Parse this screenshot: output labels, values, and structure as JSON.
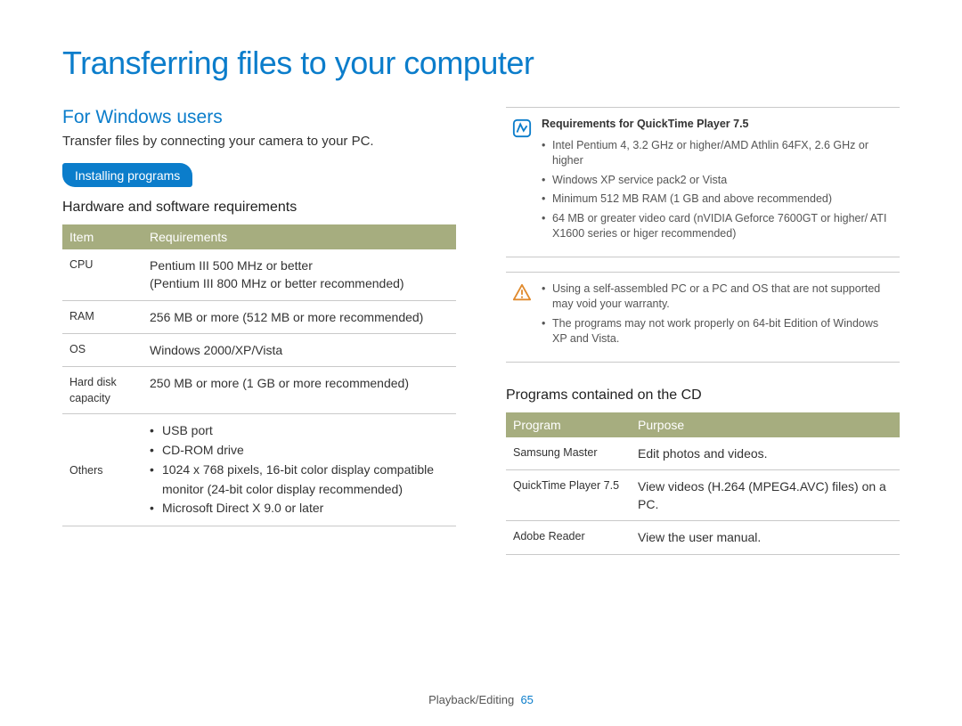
{
  "title": "Transferring files to your computer",
  "left": {
    "heading": "For Windows users",
    "sub": "Transfer files by connecting your camera to your PC.",
    "pill": "Installing programs",
    "subheading": "Hardware and software requirements",
    "req_table": {
      "head_item": "Item",
      "head_req": "Requirements",
      "rows": {
        "cpu_item": "CPU",
        "cpu_req_l1": "Pentium III 500 MHz or better",
        "cpu_req_l2": "(Pentium III 800 MHz or better recommended)",
        "ram_item": "RAM",
        "ram_req": "256 MB or more (512 MB or more recommended)",
        "os_item": "OS",
        "os_req": "Windows 2000/XP/Vista",
        "hd_item_l1": "Hard disk",
        "hd_item_l2": "capacity",
        "hd_req": "250 MB or more (1 GB or more recommended)",
        "others_item": "Others",
        "others_b1": "USB port",
        "others_b2": "CD-ROM drive",
        "others_b3": "1024 x 768 pixels, 16-bit color display compatible monitor (24-bit color display recommended)",
        "others_b4": "Microsoft Direct X 9.0 or later"
      }
    }
  },
  "right": {
    "note1_title": "Requirements for QuickTime Player 7.5",
    "note1": {
      "b1": "Intel Pentium 4, 3.2 GHz or higher/AMD Athlin 64FX, 2.6 GHz or higher",
      "b2": "Windows XP service pack2 or Vista",
      "b3": "Minimum 512 MB RAM (1 GB and above recommended)",
      "b4": "64 MB or greater video card (nVIDIA Geforce 7600GT or higher/ ATI X1600 series or higer recommended)"
    },
    "note2": {
      "b1": "Using a self-assembled PC or a PC and OS that are not supported may void your warranty.",
      "b2": "The programs may not work properly on 64-bit Edition of Windows XP and Vista."
    },
    "subheading": "Programs contained on the CD",
    "prog_table": {
      "head_prog": "Program",
      "head_purpose": "Purpose",
      "rows": {
        "r1_prog": "Samsung Master",
        "r1_purpose": "Edit photos and videos.",
        "r2_prog": "QuickTime Player 7.5",
        "r2_purpose": "View videos (H.264 (MPEG4.AVC) files) on a PC.",
        "r3_prog": "Adobe Reader",
        "r3_purpose": "View the user manual."
      }
    }
  },
  "footer": {
    "section": "Playback/Editing",
    "page": "65"
  },
  "colors": {
    "accent": "#0b7dcb",
    "thead": "#a6ad7f",
    "warn": "#e08a2e"
  }
}
